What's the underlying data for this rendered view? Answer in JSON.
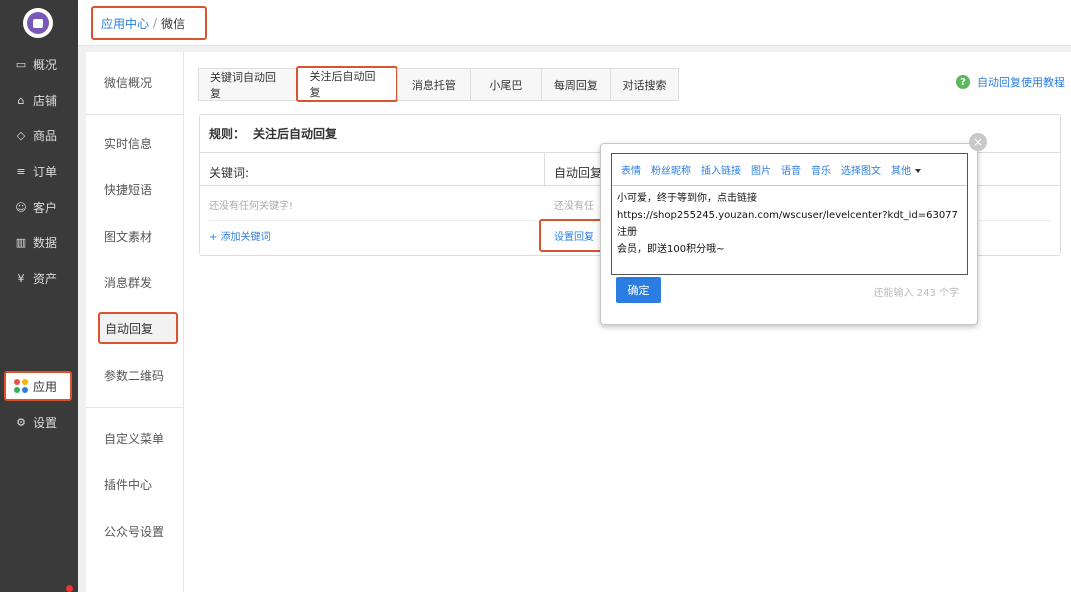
{
  "sidebar": {
    "items": [
      {
        "label": "概况",
        "icon": "monitor-icon",
        "glyph": "▭"
      },
      {
        "label": "店铺",
        "icon": "store-icon",
        "glyph": "⌂"
      },
      {
        "label": "商品",
        "icon": "tag-icon",
        "glyph": "◇"
      },
      {
        "label": "订单",
        "icon": "list-icon",
        "glyph": "≡"
      },
      {
        "label": "客户",
        "icon": "user-icon",
        "glyph": "☺"
      },
      {
        "label": "数据",
        "icon": "bar-chart-icon",
        "glyph": "▥"
      },
      {
        "label": "资产",
        "icon": "currency-icon",
        "glyph": "¥"
      }
    ],
    "app_label": "应用",
    "settings_label": "设置",
    "settings_glyph": "⚙",
    "app_dot_colors": [
      "#f04e4e",
      "#f7b500",
      "#2fb45a",
      "#2b7de1"
    ]
  },
  "breadcrumb": {
    "parent": "应用中心",
    "separator": "/",
    "current": "微信"
  },
  "subnav": {
    "items": [
      "微信概况",
      "实时信息",
      "快捷短语",
      "图文素材",
      "消息群发",
      "自动回复",
      "参数二维码",
      "自定义菜单",
      "插件中心",
      "公众号设置"
    ]
  },
  "tabs": [
    "关键词自动回复",
    "关注后自动回复",
    "消息托管",
    "小尾巴",
    "每周回复",
    "对话搜索"
  ],
  "help": {
    "icon_glyph": "?",
    "label": "自动回复使用教程"
  },
  "rule": {
    "title_prefix": "规则：",
    "title": "关注后自动回复",
    "keyword_header": "关键词:",
    "autoreply_header": "自动回复",
    "empty_keyword": "还没有任何关键字!",
    "empty_autoreply": "还没有任",
    "add_keyword": "+ 添加关键词",
    "set_reply": "设置回复"
  },
  "popover": {
    "close_glyph": "×",
    "toolbar": [
      "表情",
      "粉丝昵称",
      "插入链接",
      "图片",
      "语音",
      "音乐",
      "选择图文",
      "其他"
    ],
    "content_lines": [
      "小可爱，终于等到你，点击链接",
      "https://shop255245.youzan.com/wscuser/levelcenter?kdt_id=63077注册",
      "会员，即送100积分哦~"
    ],
    "confirm_label": "确定",
    "counter": "还能输入 243 个字"
  }
}
